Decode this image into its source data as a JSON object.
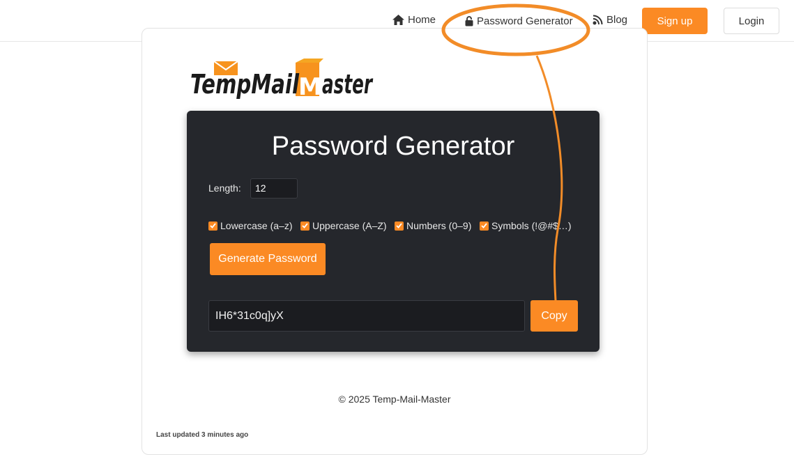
{
  "nav": {
    "home": "Home",
    "password_generator": "Password Generator",
    "blog": "Blog",
    "signup": "Sign up",
    "login": "Login",
    "icons": {
      "home": "home-icon",
      "password_generator": "lock-icon",
      "blog": "rss-icon"
    }
  },
  "logo": {
    "text_temp": "TempMail",
    "text_master": "aster",
    "alt": "TempMailMaster logo"
  },
  "generator": {
    "title": "Password Generator",
    "length_label": "Length:",
    "length_value": "12",
    "options": [
      {
        "label": "Lowercase (a–z)",
        "checked": true
      },
      {
        "label": "Uppercase (A–Z)",
        "checked": true
      },
      {
        "label": "Numbers (0–9)",
        "checked": true
      },
      {
        "label": "Symbols (!@#$…)",
        "checked": true
      }
    ],
    "generate_label": "Generate Password",
    "output_value": "IH6*31c0q]yX",
    "copy_label": "Copy"
  },
  "footer": {
    "copyright": "© 2025 Temp-Mail-Master",
    "last_updated": "Last updated 3 minutes ago"
  },
  "colors": {
    "accent": "#fb8a24",
    "panel": "#25272c",
    "field": "#1b1c20",
    "annotation": "#f28c28"
  }
}
